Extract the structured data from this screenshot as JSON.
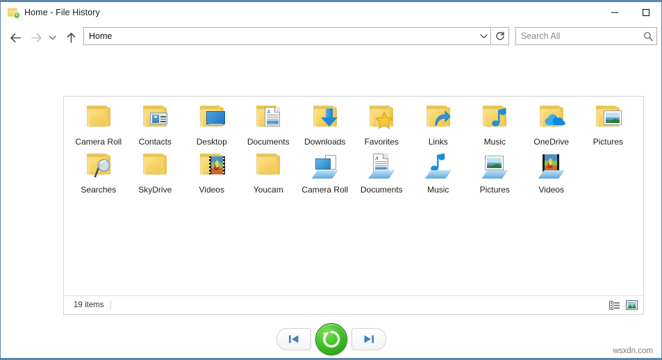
{
  "window": {
    "title": "Home - File History",
    "title_icon": "folder-history-icon",
    "controls": {
      "minimize_label": "Minimize",
      "maximize_label": "Maximize"
    }
  },
  "toolbar": {
    "back_label": "Back",
    "forward_label": "Forward",
    "recent_label": "Recent locations",
    "up_label": "Up",
    "refresh_label": "Refresh",
    "address_value": "Home",
    "search_placeholder": "Search All",
    "search_icon": "search-icon"
  },
  "content": {
    "rows": [
      [
        {
          "label": "Camera Roll",
          "icon": "folder-plain-icon",
          "kind": "folder",
          "overlay": "none"
        },
        {
          "label": "Contacts",
          "icon": "folder-contacts-icon",
          "kind": "folder",
          "overlay": "card"
        },
        {
          "label": "Desktop",
          "icon": "folder-desktop-icon",
          "kind": "folder",
          "overlay": "monitor"
        },
        {
          "label": "Documents",
          "icon": "folder-documents-icon",
          "kind": "folder",
          "overlay": "document"
        },
        {
          "label": "Downloads",
          "icon": "folder-downloads-icon",
          "kind": "folder",
          "overlay": "download-arrow"
        },
        {
          "label": "Favorites",
          "icon": "folder-favorites-icon",
          "kind": "folder",
          "overlay": "star"
        },
        {
          "label": "Links",
          "icon": "folder-links-icon",
          "kind": "folder",
          "overlay": "link-arrow"
        },
        {
          "label": "Music",
          "icon": "folder-music-icon",
          "kind": "folder",
          "overlay": "music-note"
        },
        {
          "label": "OneDrive",
          "icon": "folder-onedrive-icon",
          "kind": "folder",
          "overlay": "cloud"
        },
        {
          "label": "Pictures",
          "icon": "folder-pictures-icon",
          "kind": "folder",
          "overlay": "picture"
        }
      ],
      [
        {
          "label": "Searches",
          "icon": "folder-searches-icon",
          "kind": "folder",
          "overlay": "magnifier"
        },
        {
          "label": "SkyDrive",
          "icon": "folder-skydrive-icon",
          "kind": "folder",
          "overlay": "none"
        },
        {
          "label": "Videos",
          "icon": "folder-videos-icon",
          "kind": "folder",
          "overlay": "film"
        },
        {
          "label": "Youcam",
          "icon": "folder-youcam-icon",
          "kind": "folder",
          "overlay": "none"
        },
        {
          "label": "Camera Roll",
          "icon": "library-camera-roll-icon",
          "kind": "library",
          "overlay": "camera"
        },
        {
          "label": "Documents",
          "icon": "library-documents-icon",
          "kind": "library",
          "overlay": "document"
        },
        {
          "label": "Music",
          "icon": "library-music-icon",
          "kind": "library",
          "overlay": "music-note"
        },
        {
          "label": "Pictures",
          "icon": "library-pictures-icon",
          "kind": "library",
          "overlay": "picture"
        },
        {
          "label": "Videos",
          "icon": "library-videos-icon",
          "kind": "library",
          "overlay": "film"
        }
      ]
    ]
  },
  "status": {
    "item_count": "19 items",
    "view_details_icon": "details-view-icon",
    "view_large_icons_icon": "large-icons-view-icon"
  },
  "restore_controls": {
    "previous_label": "Previous version",
    "previous_icon": "skip-previous-icon",
    "restore_label": "Restore",
    "restore_icon": "restore-circular-arrow-icon",
    "next_label": "Next version",
    "next_icon": "skip-next-icon",
    "restore_color": "#33bb22"
  },
  "watermark": {
    "text": "wsxdn.com"
  }
}
